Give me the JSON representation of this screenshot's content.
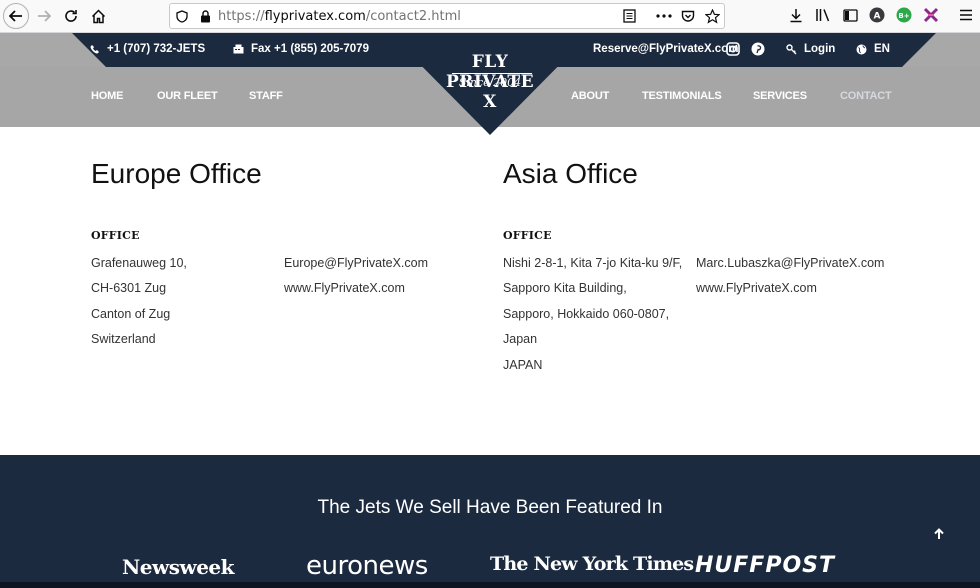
{
  "browser": {
    "url_prefix": "https://",
    "url_host": "flyprivatex.com",
    "url_path": "/contact2.html"
  },
  "topbar": {
    "phone": "+1 (707) 732-JETS",
    "fax": "Fax +1 (855) 205-7079",
    "email": "Reserve@FlyPrivateX.com",
    "login": "Login",
    "language": "EN"
  },
  "logo": {
    "name": "FLY PRIVATE X",
    "tagline": "Since 2004"
  },
  "menu": {
    "home": "HOME",
    "fleet": "OUR FLEET",
    "staff": "STAFF",
    "about": "ABOUT",
    "testimonials": "TESTIMONIALS",
    "services": "SERVICES",
    "contact": "CONTACT"
  },
  "europe": {
    "title": "Europe Office",
    "label": "OFFICE",
    "address": [
      "Grafenauweg 10,",
      "CH-6301 Zug",
      "Canton of Zug",
      "Switzerland"
    ],
    "contact": [
      "Europe@FlyPrivateX.com",
      "www.FlyPrivateX.com"
    ]
  },
  "asia": {
    "title": "Asia Office",
    "label": "OFFICE",
    "address": [
      "Nishi 2-8-1, Kita 7-jo Kita-ku 9/F,",
      "Sapporo Kita Building,",
      "Sapporo, Hokkaido 060-0807,",
      "Japan",
      "JAPAN"
    ],
    "contact": [
      "Marc.Lubaszka@FlyPrivateX.com",
      "www.FlyPrivateX.com"
    ]
  },
  "featured": {
    "title": "The Jets We Sell Have Been Featured In",
    "publications": [
      "Newsweek",
      "euronews",
      "The New York Times",
      "HUFFPOST"
    ]
  },
  "colors": {
    "navy": "#1c2a3f",
    "menu_gray": "#a6a6a6"
  }
}
